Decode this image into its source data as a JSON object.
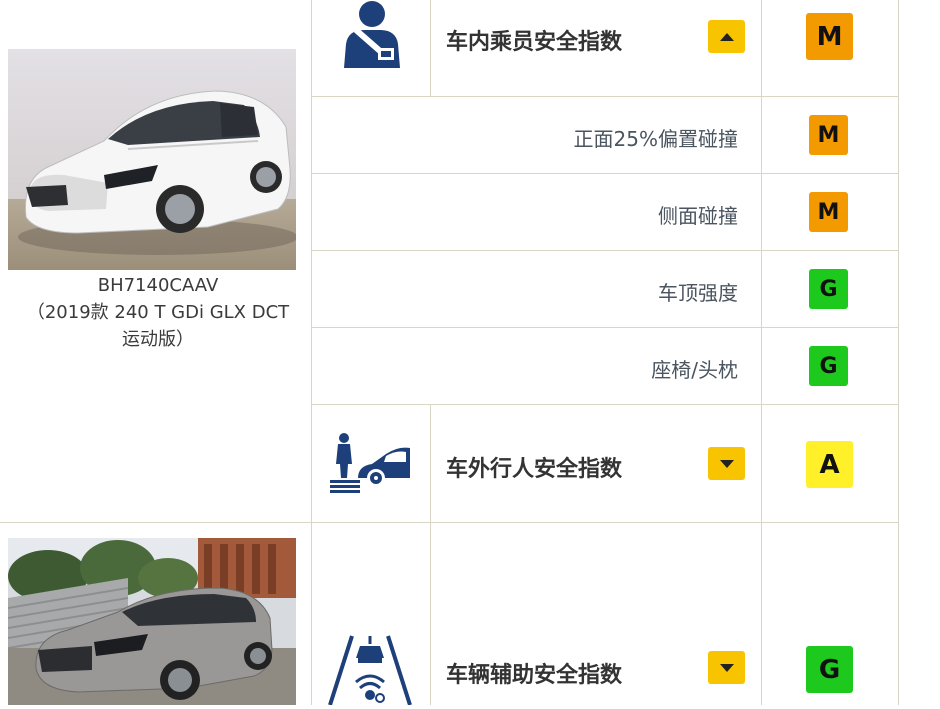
{
  "colors": {
    "toggle": "#f8c400",
    "rating_M": "#f39a00",
    "rating_G": "#1dc91d",
    "rating_A": "#fff02a",
    "icon_navy": "#1d3f7a",
    "grid": "#d9d6c6"
  },
  "cars": [
    {
      "model": "BH7140CAAV",
      "variant": "（2019款 240 T GDi GLX DCT",
      "variant2": "运动版）",
      "photo": "white-sedan-photo"
    },
    {
      "photo": "grey-sedan-photo"
    }
  ],
  "categories": [
    {
      "title": "车内乘员安全指数",
      "icon": "seatbelt-occupant-icon",
      "toggle": "collapse",
      "rating": "M",
      "subitems": [
        {
          "label": "正面25%偏置碰撞",
          "rating": "M"
        },
        {
          "label": "侧面碰撞",
          "rating": "M"
        },
        {
          "label": "车顶强度",
          "rating": "G"
        },
        {
          "label": "座椅/头枕",
          "rating": "G"
        }
      ]
    },
    {
      "title": "车外行人安全指数",
      "icon": "pedestrian-car-icon",
      "toggle": "expand",
      "rating": "A"
    },
    {
      "title": "车辆辅助安全指数",
      "icon": "driver-assist-road-icon",
      "toggle": "expand",
      "rating": "G"
    }
  ]
}
